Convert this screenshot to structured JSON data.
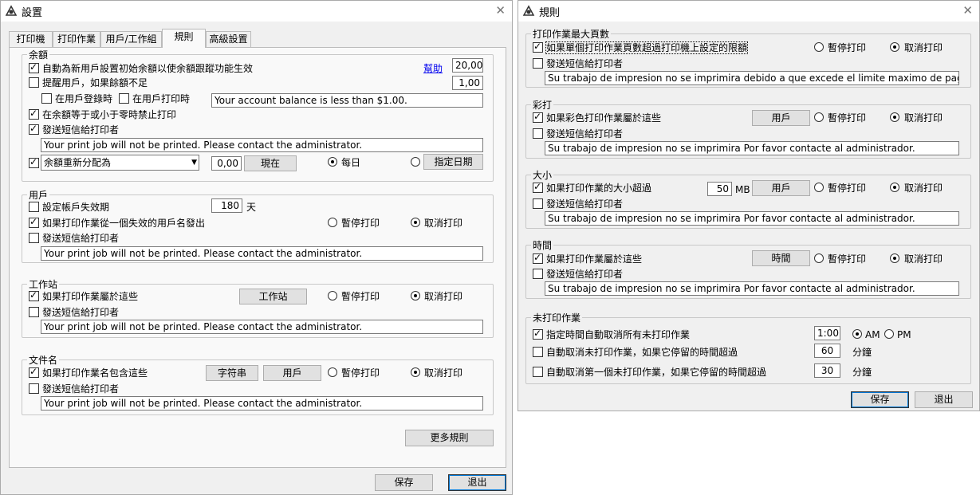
{
  "settings": {
    "title": "設置",
    "tabs": [
      "打印機",
      "打印作業",
      "用戶/工作組",
      "規則",
      "高級設置"
    ],
    "balance": {
      "legend": "余額",
      "auto_init": "自動為新用戶設置初始余額以使余額跟蹤功能生效",
      "help": "幫助",
      "init_value": "20,00",
      "remind": "提醒用戶，如果餘額不足",
      "remind_value": "1,00",
      "on_login": "在用戶登錄時",
      "on_print": "在用戶打印時",
      "remind_msg": "Your account balance is less than $1.00.",
      "zero_block": "在余額等于或小于零時禁止打印",
      "send_msg": "發送短信給打印者",
      "msg": "Your print job will not be printed. Please contact the administrator.",
      "realloc": "余額重新分配為",
      "realloc_value": "0,00",
      "now": "現在",
      "daily": "每日",
      "set_date": "指定日期"
    },
    "users": {
      "legend": "用戶",
      "expire": "設定帳戶失效期",
      "expire_value": "180",
      "days": "天",
      "invalid": "如果打印作業從一個失效的用戶名發出",
      "pause": "暫停打印",
      "cancel": "取消打印",
      "send_msg": "發送短信給打印者",
      "msg": "Your print job will not be printed. Please contact the administrator."
    },
    "workstation": {
      "legend": "工作站",
      "cond": "如果打印作業屬於這些",
      "btn": "工作站",
      "pause": "暫停打印",
      "cancel": "取消打印",
      "send_msg": "發送短信給打印者",
      "msg": "Your print job will not be printed. Please contact the administrator."
    },
    "filename": {
      "legend": "文件名",
      "cond": "如果打印作業名包含這些",
      "btn_str": "字符串",
      "btn_user": "用戶",
      "pause": "暫停打印",
      "cancel": "取消打印",
      "send_msg": "發送短信給打印者",
      "msg": "Your print job will not be printed. Please contact the administrator."
    },
    "more_rules": "更多規則",
    "save": "保存",
    "exit": "退出"
  },
  "rules": {
    "title": "規則",
    "max_pages": {
      "legend": "打印作業最大頁數",
      "cond": "如果單個打印作業頁數超過打印機上設定的限額",
      "pause": "暫停打印",
      "cancel": "取消打印",
      "send_msg": "發送短信給打印者",
      "msg": "Su trabajo de impresion no se imprimira debido a que excede el limite maximo de paginas por trabajo."
    },
    "color": {
      "legend": "彩打",
      "cond": "如果彩色打印作業屬於這些",
      "btn": "用戶",
      "pause": "暫停打印",
      "cancel": "取消打印",
      "send_msg": "發送短信給打印者",
      "msg": "Su trabajo de impresion no se imprimira Por favor contacte al administrador."
    },
    "size": {
      "legend": "大小",
      "cond": "如果打印作業的大小超過",
      "value": "50",
      "unit": "MB",
      "btn": "用戶",
      "pause": "暫停打印",
      "cancel": "取消打印",
      "send_msg": "發送短信給打印者",
      "msg": "Su trabajo de impresion no se imprimira Por favor contacte al administrador."
    },
    "time": {
      "legend": "時間",
      "cond": "如果打印作業屬於這些",
      "btn": "時間",
      "pause": "暫停打印",
      "cancel": "取消打印",
      "send_msg": "發送短信給打印者",
      "msg": "Su trabajo de impresion no se imprimira Por favor contacte al administrador."
    },
    "unprinted": {
      "legend": "未打印作業",
      "auto_cancel_all": "指定時間自動取消所有未打印作業",
      "time_value": "1:00",
      "am": "AM",
      "pm": "PM",
      "cancel_idle": "自動取消未打印作業，如果它停留的時間超過",
      "idle_value": "60",
      "minutes1": "分鐘",
      "cancel_first": "自動取消第一個未打印作業，如果它停留的時間超過",
      "first_value": "30",
      "minutes2": "分鐘"
    },
    "save": "保存",
    "exit": "退出"
  }
}
